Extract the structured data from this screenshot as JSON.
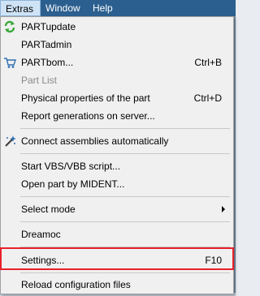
{
  "menubar": {
    "items": [
      {
        "label": "Extras"
      },
      {
        "label": "Window"
      },
      {
        "label": "Help"
      }
    ]
  },
  "menu": {
    "partupdate": {
      "label": "PARTupdate",
      "icon": "refresh-icon"
    },
    "partadmin": {
      "label": "PARTadmin"
    },
    "partbom": {
      "label": "PARTbom...",
      "shortcut": "Ctrl+B",
      "icon": "cart-icon"
    },
    "partlist": {
      "label": "Part List"
    },
    "physical": {
      "label": "Physical properties of the part",
      "shortcut": "Ctrl+D"
    },
    "report": {
      "label": "Report generations on server..."
    },
    "connect": {
      "label": "Connect assemblies automatically",
      "icon": "magic-wand-icon"
    },
    "vbs": {
      "label": "Start VBS/VBB script..."
    },
    "midend": {
      "label": "Open part by MIDENT..."
    },
    "selectmode": {
      "label": "Select mode"
    },
    "dreamoc": {
      "label": "Dreamoc"
    },
    "settings": {
      "label": "Settings...",
      "shortcut": "F10"
    },
    "reload": {
      "label": "Reload configuration files"
    }
  },
  "colors": {
    "menubar_bg": "#2b5f8f",
    "menu_bg": "#f0f0f0",
    "highlight": "#e8202a"
  }
}
